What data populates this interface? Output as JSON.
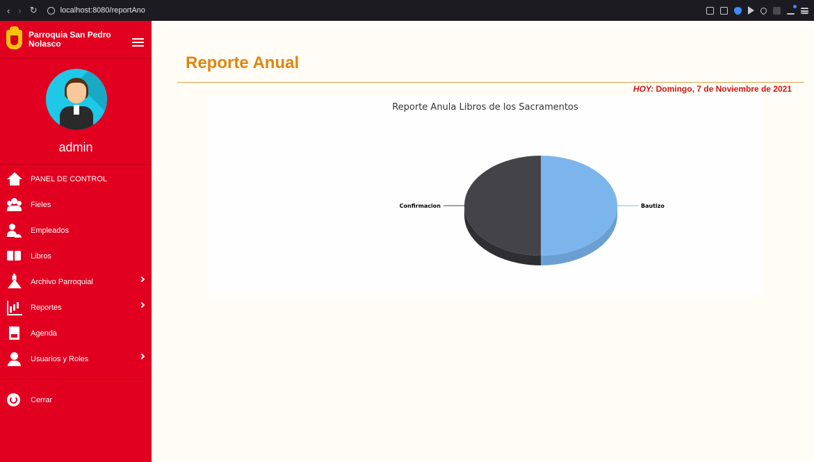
{
  "browser": {
    "url": "localhost:8080/reportAno"
  },
  "sidebar": {
    "brand_name": "Parroquia San Pedro Nolasco",
    "user_name": "admin",
    "items": [
      {
        "label": "PANEL DE CONTROL",
        "icon": "home-icon",
        "has_submenu": false
      },
      {
        "label": "Fieles",
        "icon": "users-group-icon",
        "has_submenu": false
      },
      {
        "label": "Empleados",
        "icon": "employee-icon",
        "has_submenu": false
      },
      {
        "label": "Libros",
        "icon": "book-icon",
        "has_submenu": false
      },
      {
        "label": "Archivo Parroquial",
        "icon": "church-icon",
        "has_submenu": true
      },
      {
        "label": "Reportes",
        "icon": "chart-report-icon",
        "has_submenu": true
      },
      {
        "label": "Agenda",
        "icon": "agenda-icon",
        "has_submenu": false
      },
      {
        "label": "Usuarios y Roles",
        "icon": "user-icon",
        "has_submenu": true
      }
    ],
    "logout_label": "Cerrar"
  },
  "main": {
    "title": "Reporte Anual",
    "date_prefix": "HOY:",
    "date_text": " Domingo, 7 de Noviembre de 2021"
  },
  "colors": {
    "sidebar_bg": "#e10020",
    "title": "#e08412",
    "date": "#d11414",
    "series_bautizo": "#7cb5ec",
    "series_confirmacion": "#434348"
  },
  "chart_data": {
    "type": "pie",
    "title": "Reporte Anula Libros de los Sacramentos",
    "categories": [
      "Bautizo",
      "Confirmacion"
    ],
    "values": [
      50,
      50
    ],
    "legend": "none",
    "style": "3d"
  }
}
